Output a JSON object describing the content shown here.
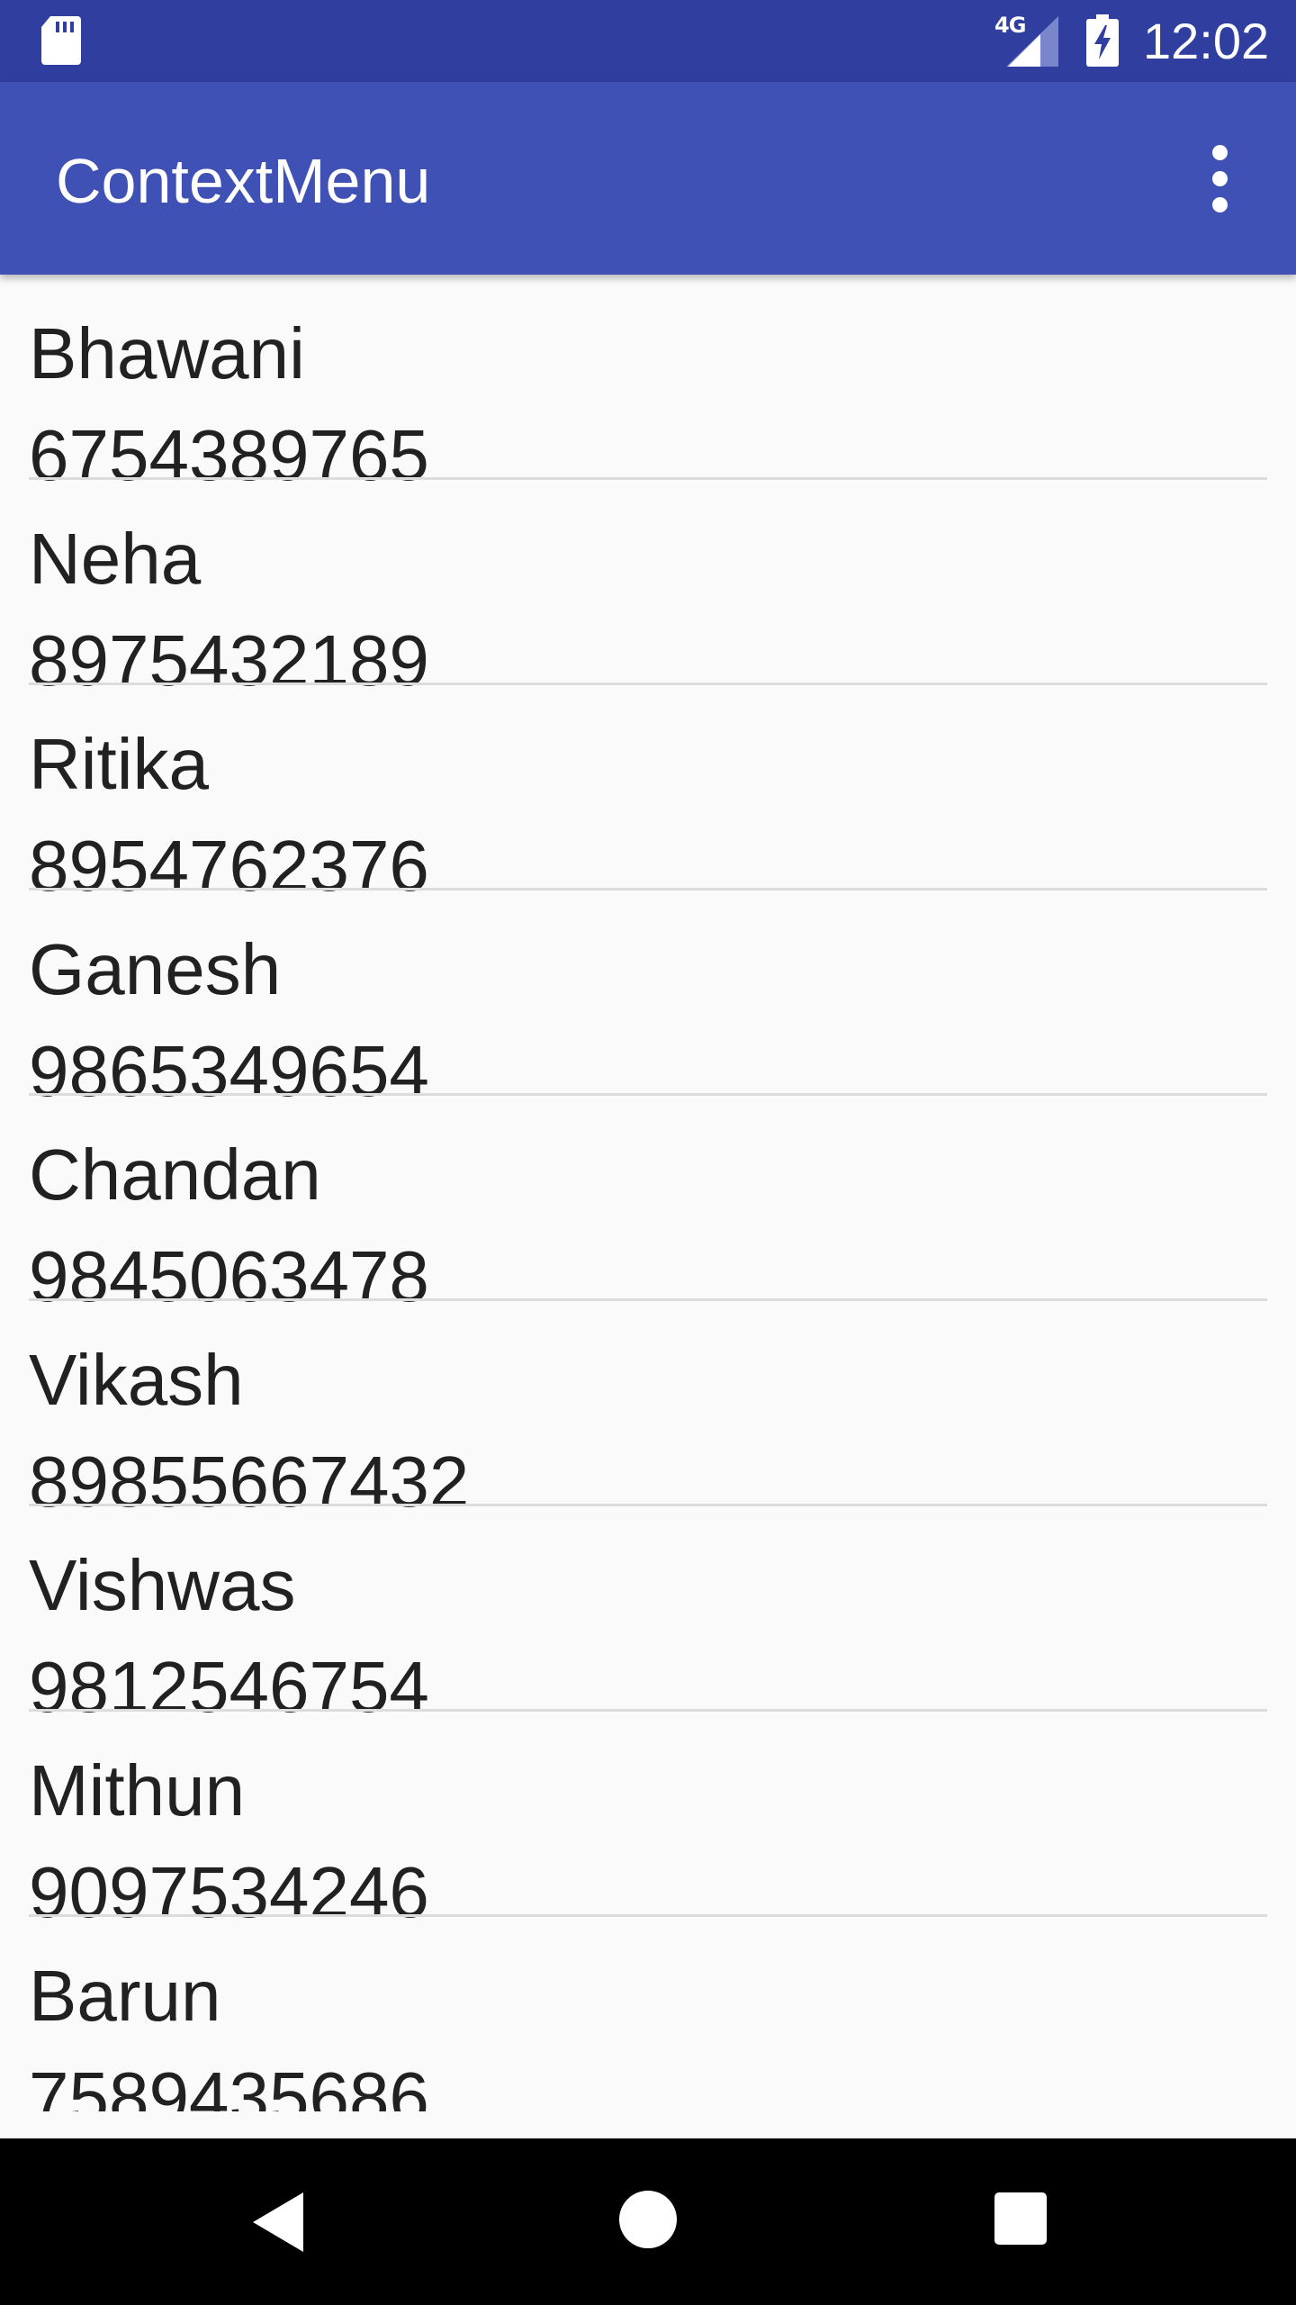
{
  "status_bar": {
    "network": "4G",
    "time": "12:02"
  },
  "app_bar": {
    "title": "ContextMenu",
    "overflow_icon": "more-vert-icon"
  },
  "contacts": [
    {
      "name": "Bhawani",
      "phone": "6754389765"
    },
    {
      "name": "Neha",
      "phone": "8975432189"
    },
    {
      "name": "Ritika",
      "phone": "8954762376"
    },
    {
      "name": "Ganesh",
      "phone": "9865349654"
    },
    {
      "name": "Chandan",
      "phone": "9845063478"
    },
    {
      "name": "Vikash",
      "phone": "89855667432"
    },
    {
      "name": "Vishwas",
      "phone": "9812546754"
    },
    {
      "name": "Mithun",
      "phone": "9097534246"
    },
    {
      "name": "Barun",
      "phone": "7589435686"
    }
  ],
  "nav_bar": {
    "back_icon": "back-triangle-icon",
    "home_icon": "home-circle-icon",
    "recents_icon": "recents-square-icon"
  },
  "colors": {
    "status_bar": "#303f9f",
    "app_bar": "#3f51b5",
    "background": "#fafafa",
    "text": "#212121",
    "divider": "#dcdcdc",
    "nav_bar": "#000000"
  }
}
